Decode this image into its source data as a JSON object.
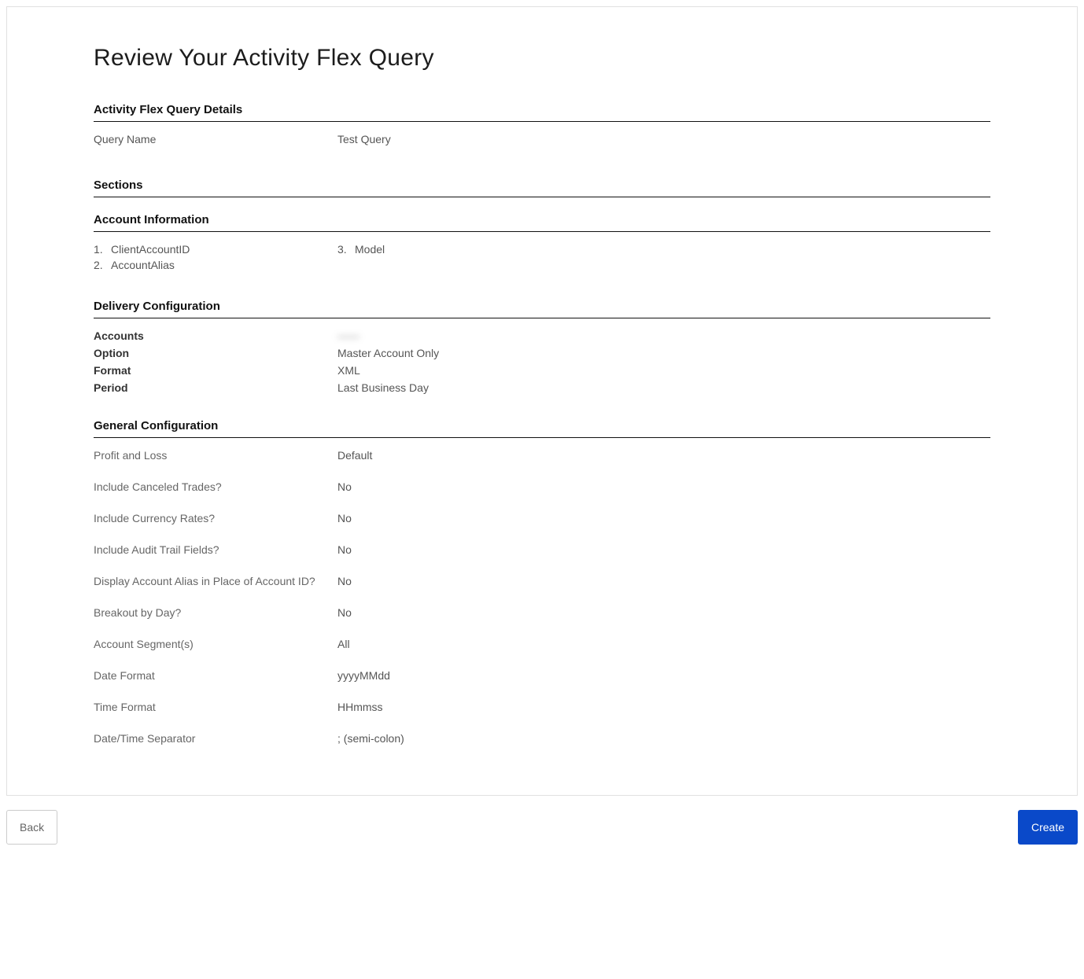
{
  "title": "Review Your Activity Flex Query",
  "headings": {
    "details": "Activity Flex Query Details",
    "sections": "Sections",
    "accountInfo": "Account Information",
    "delivery": "Delivery Configuration",
    "general": "General Configuration"
  },
  "details": {
    "queryName": {
      "label": "Query Name",
      "value": "Test Query"
    }
  },
  "accountFields": [
    {
      "num": "1.",
      "name": "ClientAccountID"
    },
    {
      "num": "2.",
      "name": "AccountAlias"
    },
    {
      "num": "3.",
      "name": "Model"
    }
  ],
  "delivery": {
    "accounts": {
      "label": "Accounts",
      "value": "——"
    },
    "option": {
      "label": "Option",
      "value": "Master Account Only"
    },
    "format": {
      "label": "Format",
      "value": "XML"
    },
    "period": {
      "label": "Period",
      "value": "Last Business Day"
    }
  },
  "general": [
    {
      "label": "Profit and Loss",
      "value": "Default"
    },
    {
      "label": "Include Canceled Trades?",
      "value": "No"
    },
    {
      "label": "Include Currency Rates?",
      "value": "No"
    },
    {
      "label": "Include Audit Trail Fields?",
      "value": "No"
    },
    {
      "label": "Display Account Alias in Place of Account ID?",
      "value": "No"
    },
    {
      "label": "Breakout by Day?",
      "value": "No"
    },
    {
      "label": "Account Segment(s)",
      "value": "All"
    },
    {
      "label": "Date Format",
      "value": "yyyyMMdd"
    },
    {
      "label": "Time Format",
      "value": "HHmmss"
    },
    {
      "label": "Date/Time Separator",
      "value": "; (semi-colon)"
    }
  ],
  "buttons": {
    "back": "Back",
    "create": "Create"
  }
}
